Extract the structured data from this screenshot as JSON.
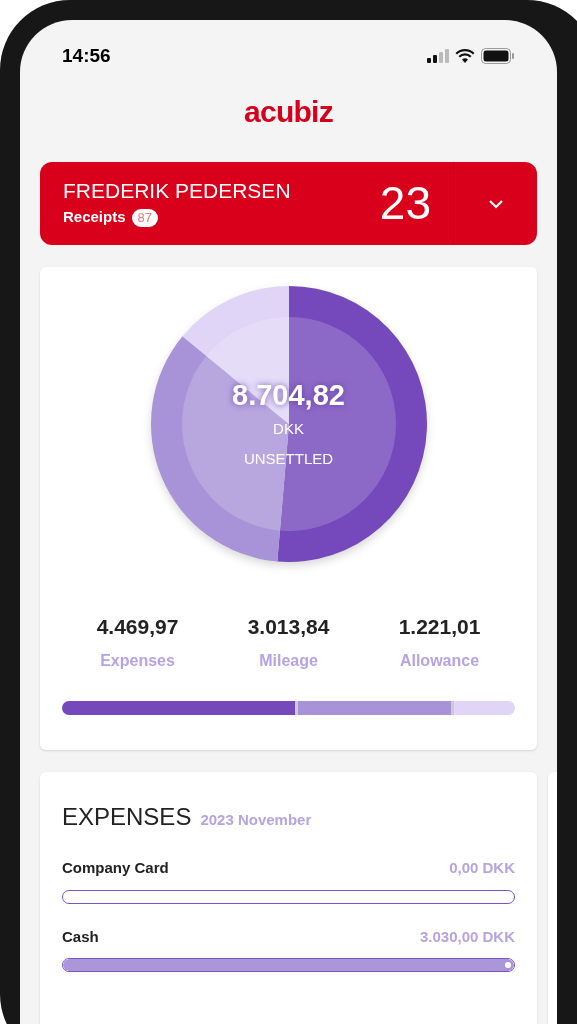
{
  "status_bar": {
    "time": "14:56"
  },
  "logo": "acubiz",
  "user_card": {
    "name": "FREDERIK PEDERSEN",
    "receipts_label": "Receipts",
    "receipts_count": "87",
    "count": "23"
  },
  "summary": {
    "total": "8.704,82",
    "currency": "DKK",
    "status": "UNSETTLED",
    "chart_data": {
      "type": "donut",
      "categories": [
        "Expenses",
        "Mileage",
        "Allowance"
      ],
      "series": [
        {
          "values": [
            51.35,
            34.62,
            14.03
          ]
        }
      ]
    },
    "segments": [
      {
        "amount": "4.469,97",
        "color": "#7549bb"
      },
      {
        "amount": "3.013,84",
        "color": "#a993d8"
      },
      {
        "amount": "1.221,01",
        "color": "#e0d5f7"
      }
    ]
  },
  "expenses": {
    "title": "EXPENSES",
    "period": "2023 November",
    "rows": [
      {
        "label": "Company Card",
        "amount": "0,00 DKK",
        "level": 0
      },
      {
        "label": "Cash",
        "amount": "3.030,00 DKK",
        "level": 1
      }
    ]
  }
}
